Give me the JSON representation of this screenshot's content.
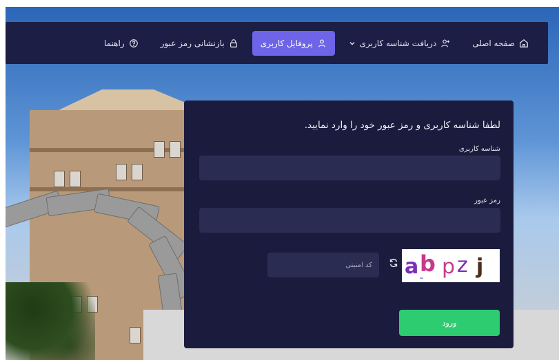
{
  "nav": {
    "items": [
      {
        "label": "صفحه اصلی",
        "icon": "home-icon"
      },
      {
        "label": "دریافت شناسه کاربری",
        "icon": "user-plus-icon",
        "has_dropdown": true
      },
      {
        "label": "پروفایل کاربری",
        "icon": "user-icon",
        "active": true
      },
      {
        "label": "بازنشانی رمز عبور",
        "icon": "lock-icon"
      },
      {
        "label": "راهنما",
        "icon": "help-circle-icon"
      }
    ]
  },
  "login": {
    "title": "لطفا شناسه کاربری و رمز عبور خود را وارد نمایید.",
    "username_label": "شناسه کاربری",
    "username_value": "",
    "password_label": "رمز عبور",
    "password_value": "",
    "captcha_placeholder": "کد امنیتی",
    "captcha_text": "ab pzj",
    "submit_label": "ورود"
  },
  "colors": {
    "nav_bg": "#1c1e45",
    "active_tab": "#6d64e8",
    "card_bg": "#1b1c3d",
    "input_bg": "#2b2c52",
    "submit_bg": "#2ecc71"
  }
}
